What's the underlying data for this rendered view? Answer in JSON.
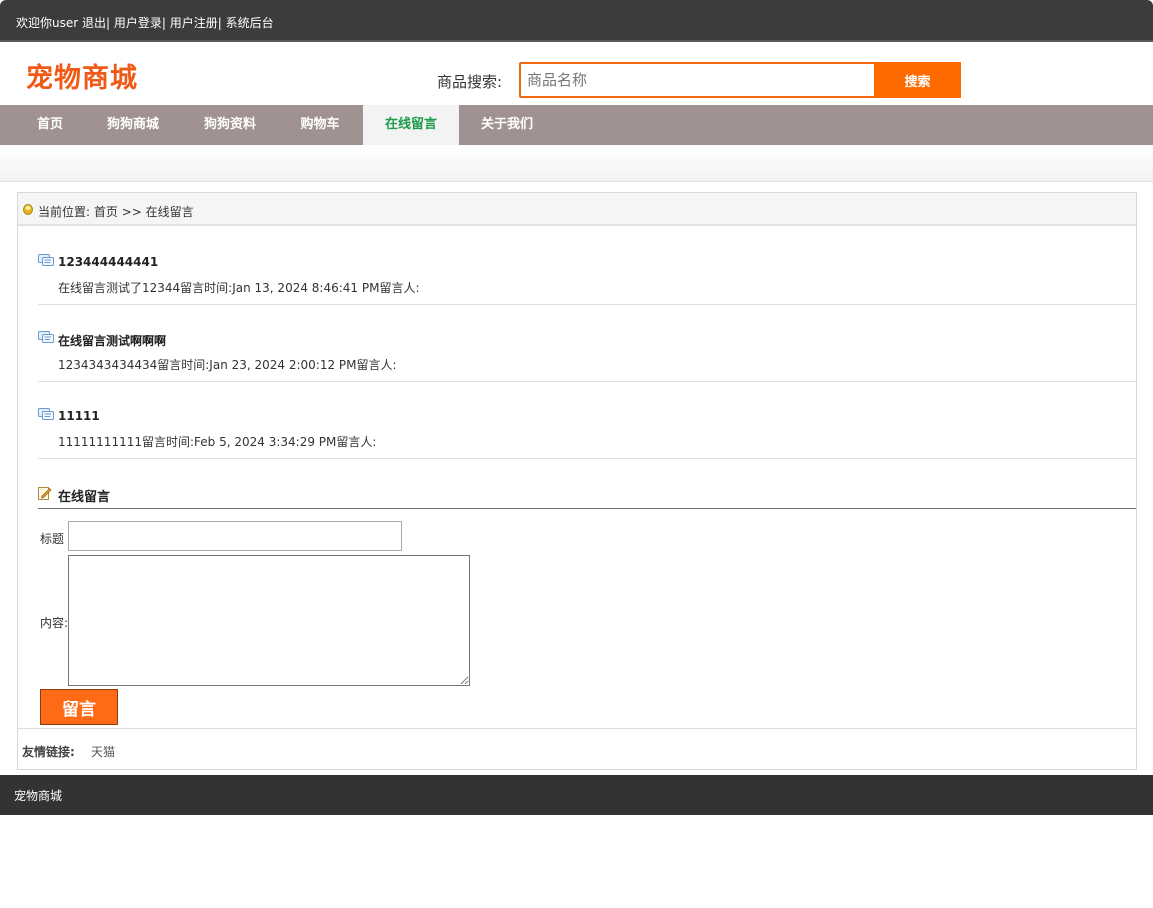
{
  "topbar": {
    "welcome": "欢迎你user",
    "logout": "退出|",
    "login": "用户登录|",
    "register": "用户注册|",
    "admin": "系统后台"
  },
  "header": {
    "logo": "宠物商城",
    "search_label": "商品搜索:",
    "search_placeholder": "商品名称",
    "search_button": "搜索"
  },
  "nav": {
    "items": [
      "首页",
      "狗狗商城",
      "狗狗资料",
      "购物车",
      "在线留言",
      "关于我们"
    ],
    "active": "在线留言"
  },
  "breadcrumb": {
    "label": "当前位置:",
    "home": "首页",
    "sep": ">>",
    "current": "在线留言"
  },
  "messages": [
    {
      "title": "123444444441",
      "body": "在线留言测试了12344留言时间:Jan 13, 2024 8:46:41 PM留言人:"
    },
    {
      "title": "在线留言测试啊啊啊",
      "body": "1234343434434留言时间:Jan 23, 2024 2:00:12 PM留言人:"
    },
    {
      "title": "11111",
      "body": "11111111111留言时间:Feb 5, 2024 3:34:29 PM留言人:"
    }
  ],
  "form": {
    "heading": "在线留言",
    "title_label": "标题",
    "content_label": "内容:",
    "submit": "留言"
  },
  "friend_links": {
    "label": "友情链接:",
    "items": [
      "天猫"
    ]
  },
  "footer": {
    "text": "宠物商城"
  },
  "colors": {
    "accent": "#ff6a00",
    "nav_bg": "#a09290",
    "active_tab_text": "#1d9b4a",
    "topbar_bg": "#3c3c3c"
  }
}
